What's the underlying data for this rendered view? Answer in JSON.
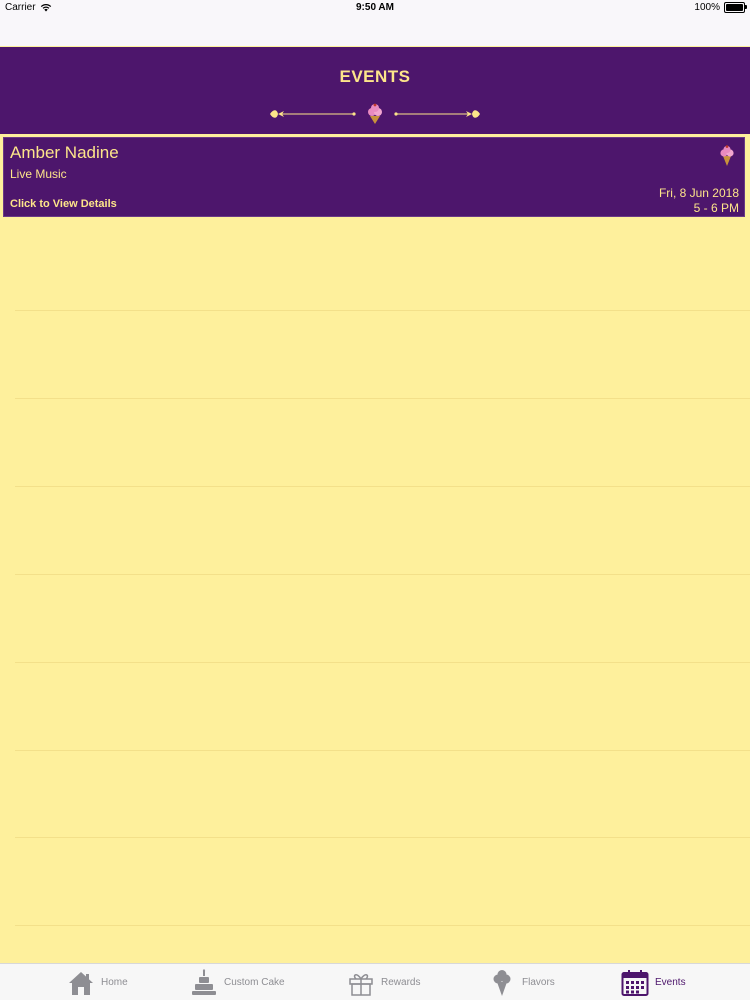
{
  "status_bar": {
    "carrier": "Carrier",
    "time": "9:50 AM",
    "battery": "100%"
  },
  "header": {
    "title": "EVENTS"
  },
  "events": [
    {
      "name": "Amber Nadine",
      "type": "Live Music",
      "details_link": "Click to View Details",
      "date": "Fri, 8 Jun 2018",
      "time": "5 - 6 PM"
    }
  ],
  "tabs": [
    {
      "label": "Home",
      "icon": "home-icon"
    },
    {
      "label": "Custom Cake",
      "icon": "cake-icon"
    },
    {
      "label": "Rewards",
      "icon": "gift-icon"
    },
    {
      "label": "Flavors",
      "icon": "ice-cream-icon"
    },
    {
      "label": "Events",
      "icon": "calendar-icon",
      "active": true
    }
  ],
  "colors": {
    "primary": "#4D166C",
    "accent": "#FDE58A",
    "background": "#FEF09C",
    "tab_inactive": "#8E8E93"
  }
}
